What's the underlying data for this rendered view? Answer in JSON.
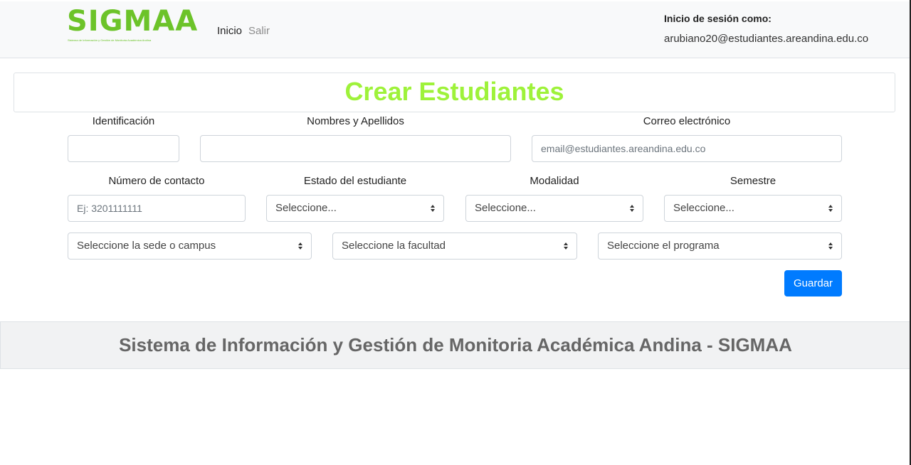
{
  "app": {
    "logo_text": "SIGMAA",
    "logo_subtitle": "Sistema de Información y Gestión de Monitoria Académica Andina",
    "brand_color": "#6cc329",
    "accent_color": "#9ef23a",
    "primary_button_color": "#007bff"
  },
  "nav": {
    "items": [
      {
        "label": "Inicio"
      },
      {
        "label": "Salir"
      }
    ],
    "session": {
      "label": "Inicio de sesión como:",
      "email": "arubiano20@estudiantes.areandina.edu.co"
    }
  },
  "page": {
    "title": "Crear Estudiantes"
  },
  "form": {
    "identificacion": {
      "label": "Identificación",
      "value": "",
      "placeholder": ""
    },
    "nombres": {
      "label": "Nombres y Apellidos",
      "value": "",
      "placeholder": ""
    },
    "correo": {
      "label": "Correo electrónico",
      "value": "",
      "placeholder": "email@estudiantes.areandina.edu.co"
    },
    "contacto": {
      "label": "Número de contacto",
      "value": "",
      "placeholder": "Ej: 3201111111"
    },
    "estado": {
      "label": "Estado del estudiante",
      "selected": "Seleccione..."
    },
    "modalidad": {
      "label": "Modalidad",
      "selected": "Seleccione..."
    },
    "semestre": {
      "label": "Semestre",
      "selected": "Seleccione..."
    },
    "sede": {
      "selected": "Seleccione la sede o campus"
    },
    "facultad": {
      "selected": "Seleccione la facultad"
    },
    "programa": {
      "selected": "Seleccione el programa"
    },
    "submit_label": "Guardar",
    "caret_icon": "sort-caret-icon"
  },
  "footer": {
    "text": "Sistema de Información y Gestión de Monitoria Académica Andina - SIGMAA"
  }
}
